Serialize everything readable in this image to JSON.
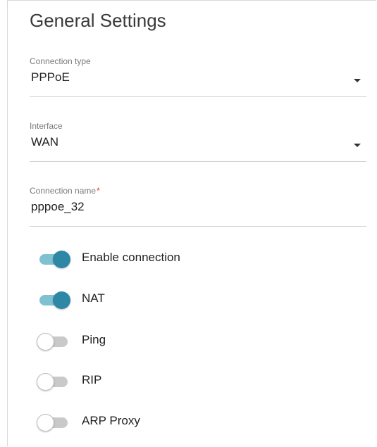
{
  "header": {
    "title": "General Settings"
  },
  "fields": {
    "connection_type": {
      "label": "Connection type",
      "value": "PPPoE"
    },
    "interface": {
      "label": "Interface",
      "value": "WAN"
    },
    "connection_name": {
      "label": "Connection name",
      "required_mark": "*",
      "value": "pppoe_32"
    }
  },
  "toggles": {
    "enable_connection": {
      "label": "Enable connection",
      "state": "on"
    },
    "nat": {
      "label": "NAT",
      "state": "on"
    },
    "ping": {
      "label": "Ping",
      "state": "off"
    },
    "rip": {
      "label": "RIP",
      "state": "off"
    },
    "arp_proxy": {
      "label": "ARP Proxy",
      "state": "off"
    }
  },
  "colors": {
    "toggle_on_knob": "#2d87a5",
    "toggle_on_track": "#7fc1d1",
    "toggle_off_track": "#c9c9c9",
    "required_mark": "#d9302c"
  }
}
